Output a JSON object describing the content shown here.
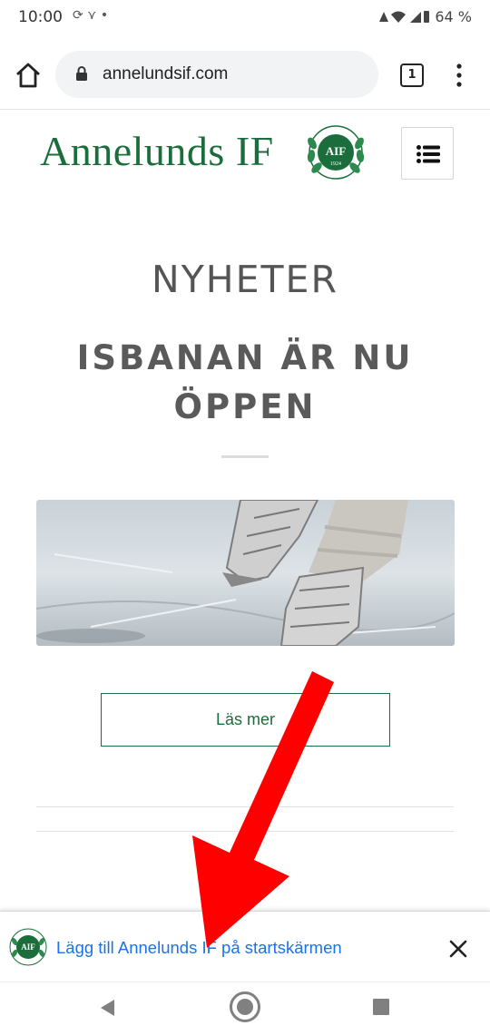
{
  "status_bar": {
    "time": "10:00",
    "left_icons": "⟳ ⋎ •",
    "right_text": "64 %"
  },
  "browser": {
    "url": "annelundsif.com",
    "tab_count": "1"
  },
  "site": {
    "logo_text": "Annelunds IF",
    "crest_text": "AIF",
    "crest_year": "1924"
  },
  "page": {
    "section_title": "NYHETER",
    "article_title": "ISBANAN ÄR NU ÖPPEN",
    "read_more_label": "Läs mer"
  },
  "install_banner": {
    "text": "Lägg till Annelunds IF på startskärmen"
  },
  "colors": {
    "brand_green": "#1b6e3b",
    "link_blue": "#1a73e8",
    "arrow_red": "#ff0000"
  }
}
